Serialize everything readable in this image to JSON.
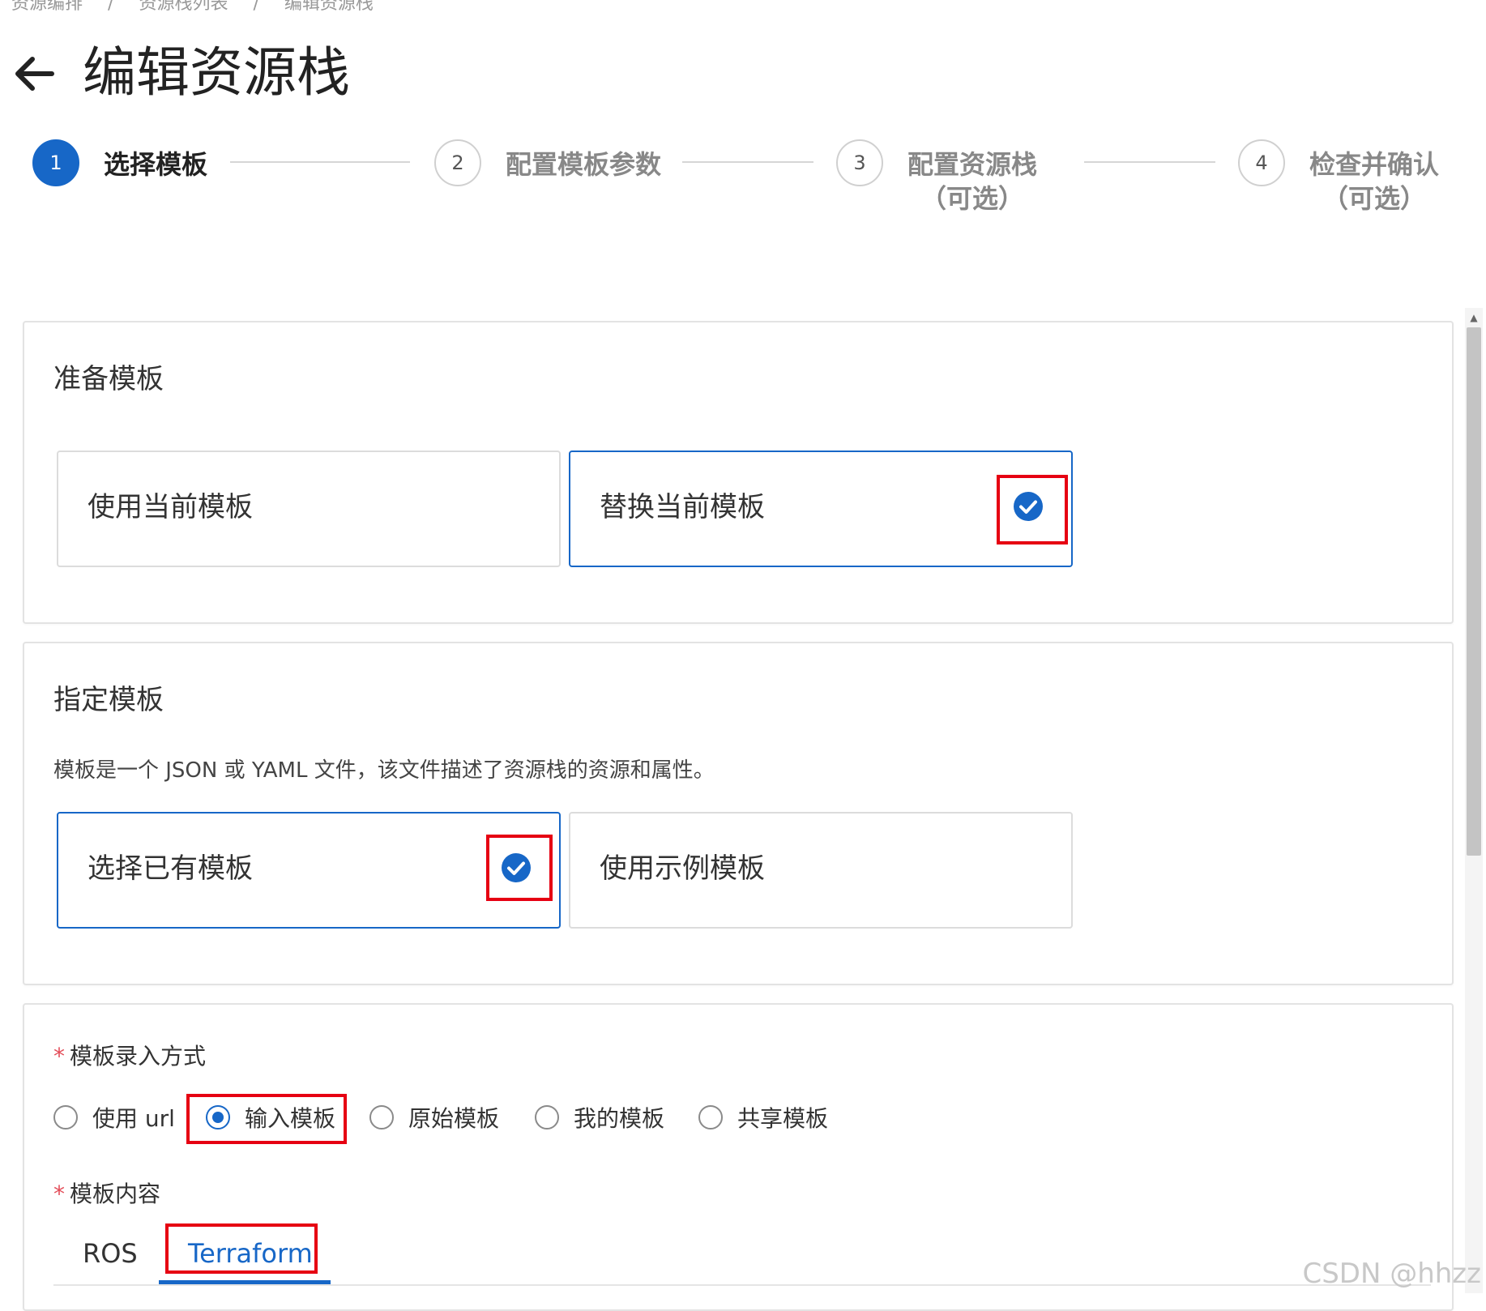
{
  "breadcrumb": [
    "资源编排",
    "资源栈列表",
    "编辑资源栈"
  ],
  "page_title": "编辑资源栈",
  "steps": [
    {
      "num": "1",
      "label_line1": "选择模板",
      "label_line2": ""
    },
    {
      "num": "2",
      "label_line1": "配置模板参数",
      "label_line2": ""
    },
    {
      "num": "3",
      "label_line1": "配置资源栈",
      "label_line2": "（可选）"
    },
    {
      "num": "4",
      "label_line1": "检查并确认",
      "label_line2": "（可选）"
    }
  ],
  "prepare_section": {
    "title": "准备模板",
    "options": [
      {
        "label": "使用当前模板",
        "selected": false
      },
      {
        "label": "替换当前模板",
        "selected": true
      }
    ]
  },
  "specify_section": {
    "title": "指定模板",
    "description": "模板是一个 JSON 或 YAML 文件，该文件描述了资源栈的资源和属性。",
    "options": [
      {
        "label": "选择已有模板",
        "selected": true
      },
      {
        "label": "使用示例模板",
        "selected": false
      }
    ]
  },
  "input_section": {
    "required_mark": "*",
    "method_label": "模板录入方式",
    "methods": [
      {
        "label": "使用 url",
        "selected": false
      },
      {
        "label": "输入模板",
        "selected": true
      },
      {
        "label": "原始模板",
        "selected": false
      },
      {
        "label": "我的模板",
        "selected": false
      },
      {
        "label": "共享模板",
        "selected": false
      }
    ],
    "content_label": "模板内容",
    "tabs": [
      {
        "label": "ROS",
        "active": false
      },
      {
        "label": "Terraform",
        "active": true
      }
    ]
  },
  "watermark": "CSDN @hhzz",
  "colors": {
    "accent": "#1767c7",
    "highlight": "#e60012",
    "required": "#e34d59"
  }
}
